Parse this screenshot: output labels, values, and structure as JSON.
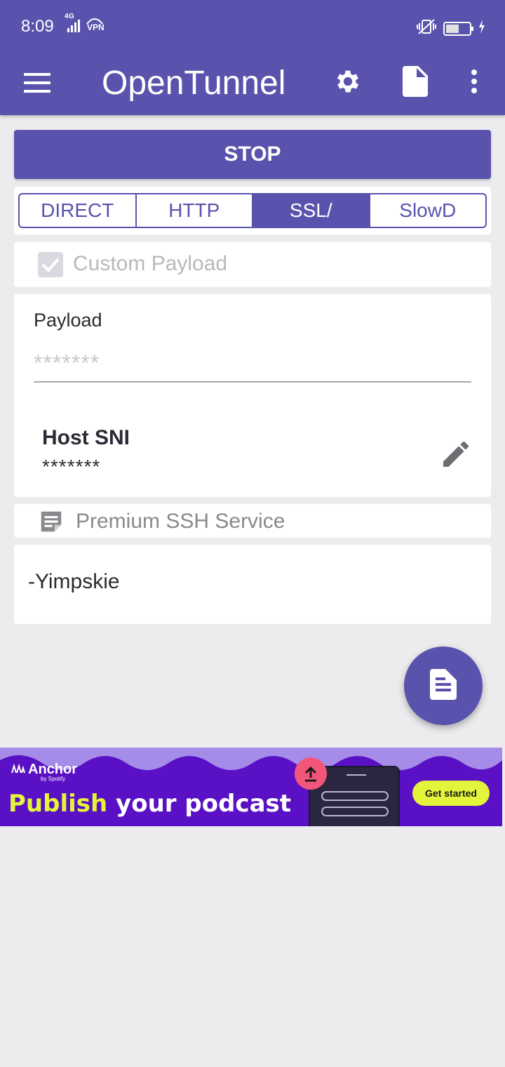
{
  "status_bar": {
    "time": "8:09",
    "network": "4G",
    "vpn": "VPN",
    "battery_level": 0.55
  },
  "app_bar": {
    "title": "OpenTunnel",
    "icons": [
      "menu-icon",
      "gear-icon",
      "file-icon",
      "more-vert-icon"
    ]
  },
  "controls": {
    "stop_label": "STOP"
  },
  "tabs": [
    {
      "label": "DIRECT",
      "active": false
    },
    {
      "label": "HTTP",
      "active": false
    },
    {
      "label": "SSL/",
      "active": true
    },
    {
      "label": "SlowD",
      "active": false
    }
  ],
  "custom_payload": {
    "label": "Custom Payload",
    "checked": true
  },
  "payload": {
    "label": "Payload",
    "placeholder": "*******"
  },
  "host": {
    "title": "Host SNI",
    "value": "*******"
  },
  "service": {
    "label": "Premium SSH Service"
  },
  "note": {
    "text": "-Yimpskie"
  },
  "ad": {
    "brand": "Anchor",
    "brand_sub": "by Spotify",
    "headline_highlight": "Publish",
    "headline_rest": " your podcast",
    "cta": "Get started"
  },
  "colors": {
    "primary": "#5a53ad",
    "background": "#ececee",
    "ad_purple": "#5a10c4",
    "ad_yellow": "#e4f43a",
    "ad_pink": "#f2567a"
  }
}
